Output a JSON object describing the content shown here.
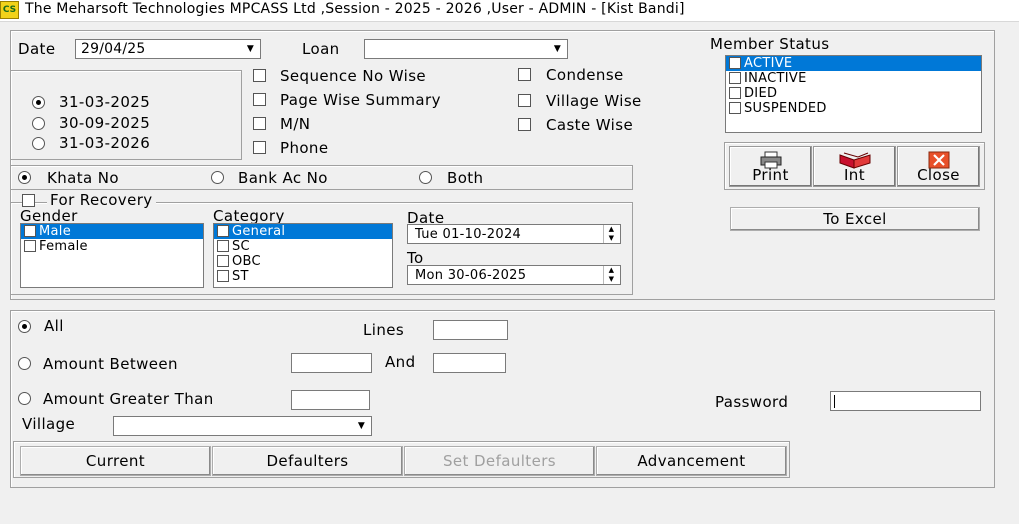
{
  "window": {
    "icon_text": "CS",
    "title": "The Meharsoft Technologies MPCASS Ltd ,Session - 2025 - 2026 ,User - ADMIN - [Kist Bandi]"
  },
  "filters": {
    "date_label": "Date",
    "date_value": "29/04/25",
    "loan_label": "Loan",
    "loan_value": "",
    "date_options": [
      "31-03-2025",
      "30-09-2025",
      "31-03-2026"
    ],
    "options_col1": [
      "Sequence No Wise",
      "Page Wise Summary",
      "M/N",
      "Phone"
    ],
    "options_col2": [
      "Condense",
      "Village Wise",
      "Caste Wise"
    ]
  },
  "member_status": {
    "label": "Member Status",
    "items": [
      "ACTIVE",
      "INACTIVE",
      "DIED",
      "SUSPENDED"
    ],
    "selected": "ACTIVE"
  },
  "toolbar": {
    "print_label": "Print",
    "int_label": "Int",
    "close_label": "Close",
    "excel_label": "To Excel"
  },
  "search_by": {
    "options": [
      "Khata No",
      "Bank Ac No",
      "Both"
    ],
    "selected": "Khata No"
  },
  "recovery": {
    "label": "For Recovery",
    "gender_label": "Gender",
    "gender_items": [
      "Male",
      "Female"
    ],
    "category_label": "Category",
    "category_items": [
      "General",
      "SC",
      "OBC",
      "ST"
    ],
    "date_label": "Date",
    "date_from": "Tue  01-10-2024",
    "to_label": "To",
    "date_to": "Mon  30-06-2025"
  },
  "amount": {
    "all_label": "All",
    "lines_label": "Lines",
    "between_label": "Amount Between",
    "and_label": "And",
    "greater_label": "Amount Greater Than",
    "password_label": "Password",
    "village_label": "Village",
    "village_value": "",
    "selected": "All"
  },
  "actions": {
    "current": "Current",
    "defaulters": "Defaulters",
    "set_defaulters": "Set Defaulters",
    "advancement": "Advancement"
  }
}
